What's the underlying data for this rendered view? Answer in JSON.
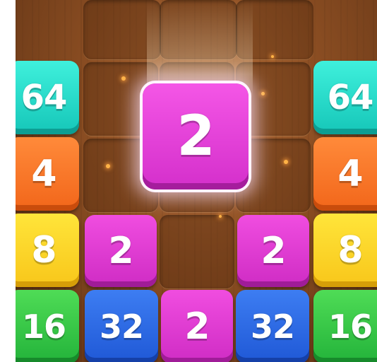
{
  "game": {
    "falling_tile": {
      "value": "2",
      "color": "#d42fcb"
    },
    "grid": {
      "rows": [
        [
          {
            "value": "64",
            "color": "cyan"
          },
          {
            "value": "",
            "color": "empty"
          },
          {
            "value": "",
            "color": "empty"
          },
          {
            "value": "",
            "color": "empty"
          },
          {
            "value": "64",
            "color": "cyan"
          }
        ],
        [
          {
            "value": "4",
            "color": "orange"
          },
          {
            "value": "",
            "color": "empty"
          },
          {
            "value": "",
            "color": "empty"
          },
          {
            "value": "",
            "color": "empty"
          },
          {
            "value": "4",
            "color": "orange"
          }
        ],
        [
          {
            "value": "8",
            "color": "yellow"
          },
          {
            "value": "2",
            "color": "pink"
          },
          {
            "value": "",
            "color": "empty"
          },
          {
            "value": "2",
            "color": "pink"
          },
          {
            "value": "8",
            "color": "yellow"
          }
        ],
        [
          {
            "value": "16",
            "color": "green"
          },
          {
            "value": "32",
            "color": "blue"
          },
          {
            "value": "2",
            "color": "pink"
          },
          {
            "value": "32",
            "color": "blue"
          },
          {
            "value": "16",
            "color": "green"
          }
        ]
      ]
    },
    "colors": {
      "cyan": "#15c6b8",
      "orange": "#f2661a",
      "yellow": "#f8c61a",
      "green": "#23b33a",
      "pink": "#cf2cc4",
      "blue": "#1f58d6",
      "board_wood": "#8a4d22"
    }
  }
}
